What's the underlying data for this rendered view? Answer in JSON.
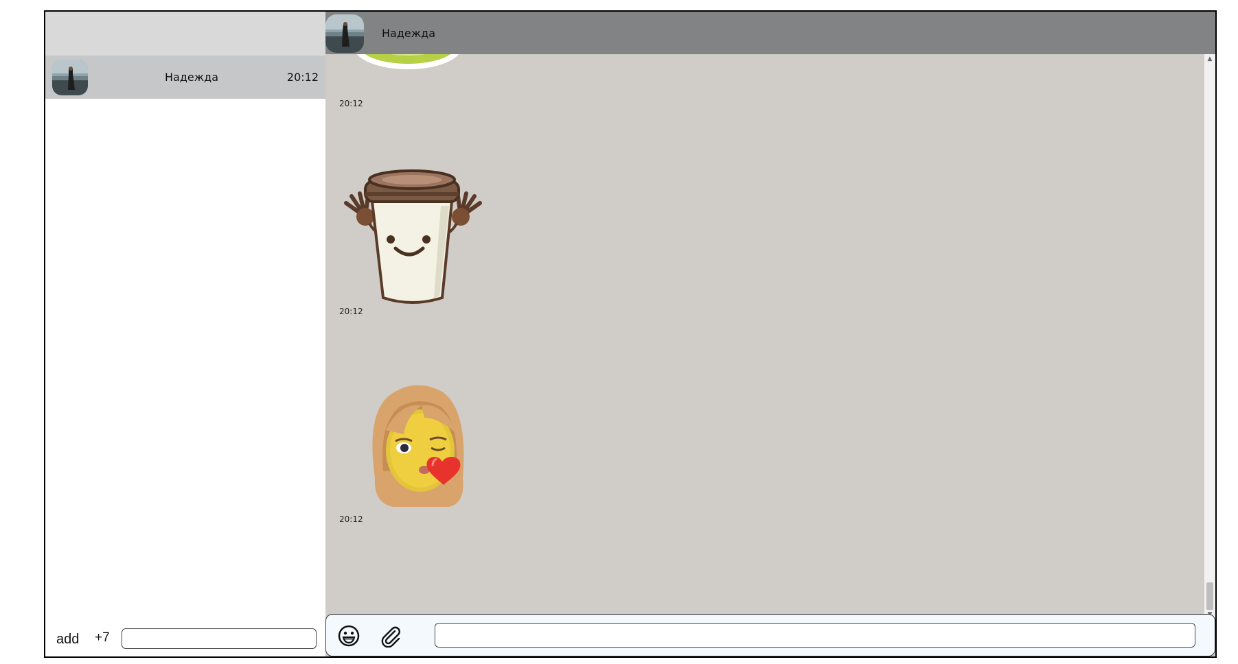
{
  "sidebar": {
    "chats": [
      {
        "name": "Надежда",
        "time": "20:12"
      }
    ],
    "footer": {
      "add_label": "add",
      "country_code": "+7",
      "phone_value": ""
    }
  },
  "chat": {
    "header": {
      "name": "Надежда"
    },
    "messages": [
      {
        "sticker": "green-sticker",
        "time": "20:12"
      },
      {
        "sticker": "coffee-cup-sticker",
        "time": "20:12"
      },
      {
        "sticker": "girl-kiss-sticker",
        "time": "20:12"
      }
    ],
    "composer": {
      "emoji_icon": "emoji-icon",
      "attach_icon": "paperclip-icon",
      "message_value": ""
    }
  },
  "colors": {
    "sidebar_header": "#d9d9da",
    "active_chat": "#c5c7c9",
    "chat_header": "#828385",
    "chat_background": "#d0cdc8",
    "composer_background": "#f4f9fd"
  }
}
